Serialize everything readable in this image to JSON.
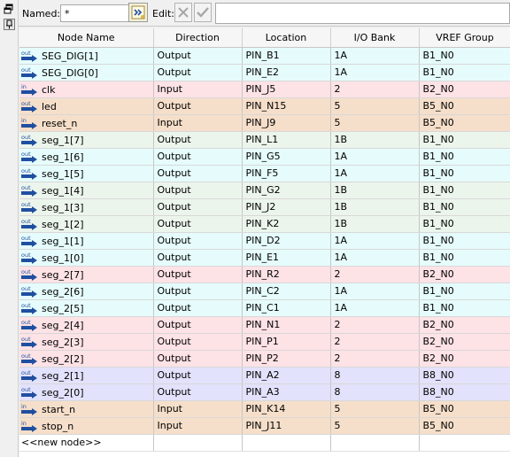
{
  "toolbar": {
    "named_label": "Named:",
    "named_value": "*",
    "edit_label": "Edit:",
    "edit_value": ""
  },
  "columns": [
    "Node Name",
    "Direction",
    "Location",
    "I/O Bank",
    "VREF Group"
  ],
  "colors": {
    "bank_1A": "#e6fcfc",
    "bank_1B": "#ecf5ec",
    "bank_2": "#fde2e6",
    "bank_5": "#f6dfca",
    "bank_8": "#e2e2fc",
    "pin_icon_blue": "#1f4fa0"
  },
  "rows": [
    {
      "name": "SEG_DIG[1]",
      "dir_icon": "output-pin-icon",
      "direction": "Output",
      "location": "PIN_B1",
      "bank": "1A",
      "vref": "B1_N0"
    },
    {
      "name": "SEG_DIG[0]",
      "dir_icon": "output-pin-icon",
      "direction": "Output",
      "location": "PIN_E2",
      "bank": "1A",
      "vref": "B1_N0"
    },
    {
      "name": "clk",
      "dir_icon": "input-pin-icon",
      "direction": "Input",
      "location": "PIN_J5",
      "bank": "2",
      "vref": "B2_N0"
    },
    {
      "name": "led",
      "dir_icon": "output-pin-icon",
      "direction": "Output",
      "location": "PIN_N15",
      "bank": "5",
      "vref": "B5_N0"
    },
    {
      "name": "reset_n",
      "dir_icon": "input-pin-icon",
      "direction": "Input",
      "location": "PIN_J9",
      "bank": "5",
      "vref": "B5_N0"
    },
    {
      "name": "seg_1[7]",
      "dir_icon": "output-pin-icon",
      "direction": "Output",
      "location": "PIN_L1",
      "bank": "1B",
      "vref": "B1_N0"
    },
    {
      "name": "seg_1[6]",
      "dir_icon": "output-pin-icon",
      "direction": "Output",
      "location": "PIN_G5",
      "bank": "1A",
      "vref": "B1_N0"
    },
    {
      "name": "seg_1[5]",
      "dir_icon": "output-pin-icon",
      "direction": "Output",
      "location": "PIN_F5",
      "bank": "1A",
      "vref": "B1_N0"
    },
    {
      "name": "seg_1[4]",
      "dir_icon": "output-pin-icon",
      "direction": "Output",
      "location": "PIN_G2",
      "bank": "1B",
      "vref": "B1_N0"
    },
    {
      "name": "seg_1[3]",
      "dir_icon": "output-pin-icon",
      "direction": "Output",
      "location": "PIN_J2",
      "bank": "1B",
      "vref": "B1_N0"
    },
    {
      "name": "seg_1[2]",
      "dir_icon": "output-pin-icon",
      "direction": "Output",
      "location": "PIN_K2",
      "bank": "1B",
      "vref": "B1_N0"
    },
    {
      "name": "seg_1[1]",
      "dir_icon": "output-pin-icon",
      "direction": "Output",
      "location": "PIN_D2",
      "bank": "1A",
      "vref": "B1_N0"
    },
    {
      "name": "seg_1[0]",
      "dir_icon": "output-pin-icon",
      "direction": "Output",
      "location": "PIN_E1",
      "bank": "1A",
      "vref": "B1_N0"
    },
    {
      "name": "seg_2[7]",
      "dir_icon": "output-pin-icon",
      "direction": "Output",
      "location": "PIN_R2",
      "bank": "2",
      "vref": "B2_N0"
    },
    {
      "name": "seg_2[6]",
      "dir_icon": "output-pin-icon",
      "direction": "Output",
      "location": "PIN_C2",
      "bank": "1A",
      "vref": "B1_N0"
    },
    {
      "name": "seg_2[5]",
      "dir_icon": "output-pin-icon",
      "direction": "Output",
      "location": "PIN_C1",
      "bank": "1A",
      "vref": "B1_N0"
    },
    {
      "name": "seg_2[4]",
      "dir_icon": "output-pin-icon",
      "direction": "Output",
      "location": "PIN_N1",
      "bank": "2",
      "vref": "B2_N0"
    },
    {
      "name": "seg_2[3]",
      "dir_icon": "output-pin-icon",
      "direction": "Output",
      "location": "PIN_P1",
      "bank": "2",
      "vref": "B2_N0"
    },
    {
      "name": "seg_2[2]",
      "dir_icon": "output-pin-icon",
      "direction": "Output",
      "location": "PIN_P2",
      "bank": "2",
      "vref": "B2_N0"
    },
    {
      "name": "seg_2[1]",
      "dir_icon": "output-pin-icon",
      "direction": "Output",
      "location": "PIN_A2",
      "bank": "8",
      "vref": "B8_N0"
    },
    {
      "name": "seg_2[0]",
      "dir_icon": "output-pin-icon",
      "direction": "Output",
      "location": "PIN_A3",
      "bank": "8",
      "vref": "B8_N0"
    },
    {
      "name": "start_n",
      "dir_icon": "input-pin-icon",
      "direction": "Input",
      "location": "PIN_K14",
      "bank": "5",
      "vref": "B5_N0"
    },
    {
      "name": "stop_n",
      "dir_icon": "input-pin-icon",
      "direction": "Input",
      "location": "PIN_J11",
      "bank": "5",
      "vref": "B5_N0"
    }
  ],
  "new_node_label": "<<new node>>"
}
